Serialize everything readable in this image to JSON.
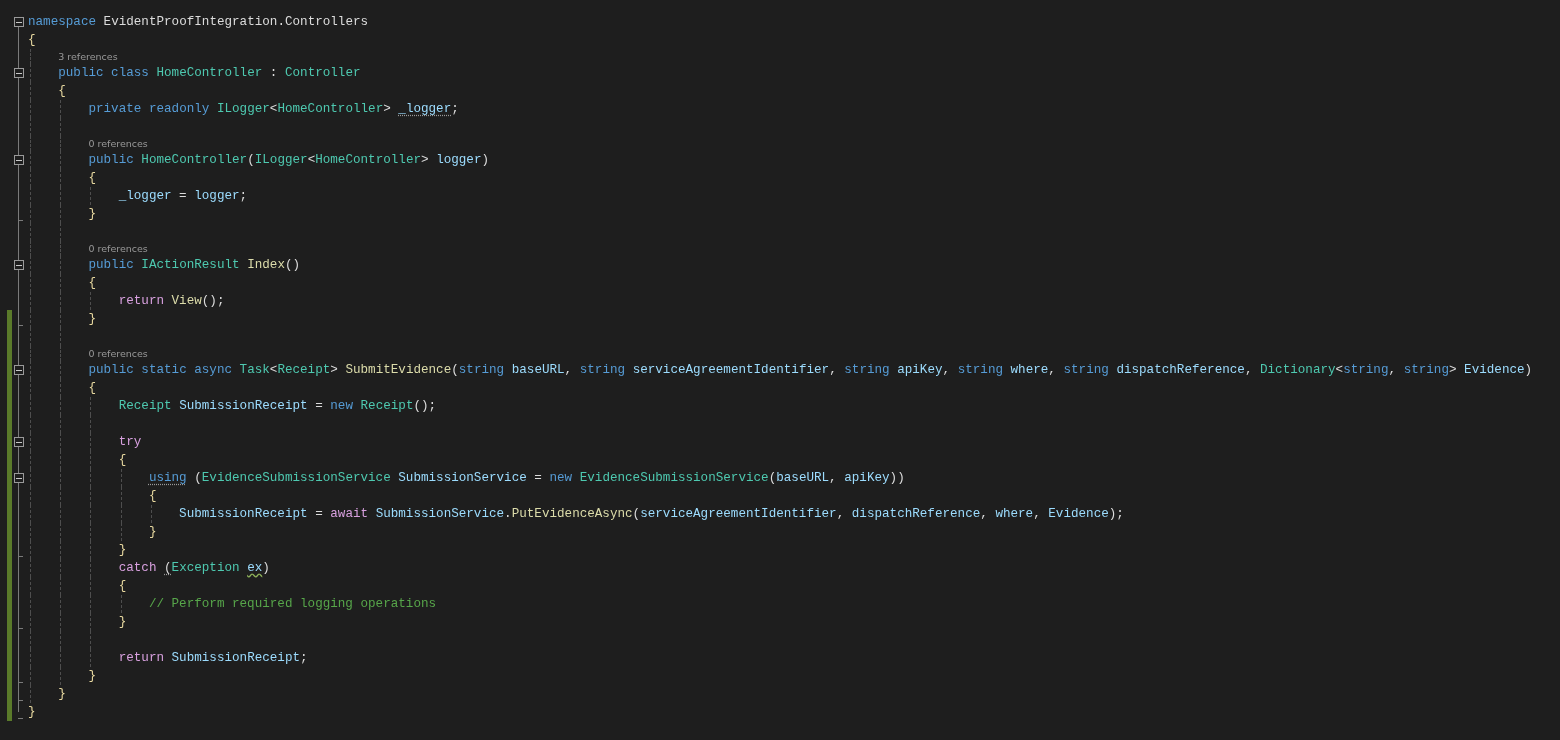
{
  "editor": {
    "lines": [
      {
        "kind": "code",
        "expanded": true,
        "modified": false,
        "tokens": [
          {
            "kind": "keyword",
            "text": "namespace "
          },
          {
            "kind": "plain",
            "text": "EvidentProofIntegration.Controllers"
          }
        ]
      },
      {
        "kind": "code",
        "modified": false,
        "tokens": [
          {
            "kind": "brace",
            "text": "{"
          }
        ],
        "children": [
          {
            "kind": "lens",
            "modified": false,
            "text": "3 references"
          },
          {
            "kind": "code",
            "expanded": true,
            "modified": false,
            "tokens": [
              {
                "kind": "keyword",
                "text": "public class "
              },
              {
                "kind": "type",
                "text": "HomeController"
              },
              {
                "kind": "plain",
                "text": " : "
              },
              {
                "kind": "type",
                "text": "Controller"
              }
            ]
          },
          {
            "kind": "code",
            "modified": false,
            "tokens": [
              {
                "kind": "brace",
                "text": "{"
              }
            ],
            "children": [
              {
                "kind": "code",
                "modified": false,
                "tokens": [
                  {
                    "kind": "keyword",
                    "text": "private readonly "
                  },
                  {
                    "kind": "type",
                    "text": "ILogger"
                  },
                  {
                    "kind": "plain",
                    "text": "<"
                  },
                  {
                    "kind": "type",
                    "text": "HomeController"
                  },
                  {
                    "kind": "plain",
                    "text": "> "
                  },
                  {
                    "kind": "variable",
                    "text": "_logger",
                    "hint": true
                  },
                  {
                    "kind": "plain",
                    "text": ";"
                  }
                ]
              },
              {
                "kind": "blank",
                "modified": false
              },
              {
                "kind": "lens",
                "modified": false,
                "text": "0 references"
              },
              {
                "kind": "code",
                "expanded": true,
                "modified": false,
                "tokens": [
                  {
                    "kind": "keyword",
                    "text": "public "
                  },
                  {
                    "kind": "type",
                    "text": "HomeController"
                  },
                  {
                    "kind": "plain",
                    "text": "("
                  },
                  {
                    "kind": "type",
                    "text": "ILogger"
                  },
                  {
                    "kind": "plain",
                    "text": "<"
                  },
                  {
                    "kind": "type",
                    "text": "HomeController"
                  },
                  {
                    "kind": "plain",
                    "text": "> "
                  },
                  {
                    "kind": "variable",
                    "text": "logger"
                  },
                  {
                    "kind": "plain",
                    "text": ")"
                  }
                ]
              },
              {
                "kind": "code",
                "modified": false,
                "tokens": [
                  {
                    "kind": "brace",
                    "text": "{"
                  }
                ],
                "children": [
                  {
                    "kind": "code",
                    "modified": false,
                    "tokens": [
                      {
                        "kind": "variable",
                        "text": "_logger"
                      },
                      {
                        "kind": "plain",
                        "text": " = "
                      },
                      {
                        "kind": "variable",
                        "text": "logger"
                      },
                      {
                        "kind": "plain",
                        "text": ";"
                      }
                    ]
                  }
                ]
              },
              {
                "kind": "code",
                "fold_end": true,
                "modified": false,
                "tokens": [
                  {
                    "kind": "brace",
                    "text": "}"
                  }
                ]
              },
              {
                "kind": "blank",
                "modified": false
              },
              {
                "kind": "lens",
                "modified": false,
                "text": "0 references"
              },
              {
                "kind": "code",
                "expanded": true,
                "modified": false,
                "tokens": [
                  {
                    "kind": "keyword",
                    "text": "public "
                  },
                  {
                    "kind": "type",
                    "text": "IActionResult"
                  },
                  {
                    "kind": "method",
                    "text": " Index"
                  },
                  {
                    "kind": "plain",
                    "text": "()"
                  }
                ]
              },
              {
                "kind": "code",
                "modified": false,
                "tokens": [
                  {
                    "kind": "brace",
                    "text": "{"
                  }
                ],
                "children": [
                  {
                    "kind": "code",
                    "modified": false,
                    "tokens": [
                      {
                        "kind": "control",
                        "text": "return "
                      },
                      {
                        "kind": "method",
                        "text": "View"
                      },
                      {
                        "kind": "plain",
                        "text": "();"
                      }
                    ]
                  }
                ]
              },
              {
                "kind": "code",
                "fold_end": true,
                "modified": true,
                "tokens": [
                  {
                    "kind": "brace",
                    "text": "}"
                  }
                ]
              },
              {
                "kind": "blank",
                "modified": true
              },
              {
                "kind": "lens",
                "modified": true,
                "text": "0 references"
              },
              {
                "kind": "code",
                "expanded": true,
                "modified": true,
                "tokens": [
                  {
                    "kind": "keyword",
                    "text": "public static async "
                  },
                  {
                    "kind": "type",
                    "text": "Task"
                  },
                  {
                    "kind": "plain",
                    "text": "<"
                  },
                  {
                    "kind": "type",
                    "text": "Receipt"
                  },
                  {
                    "kind": "plain",
                    "text": "> "
                  },
                  {
                    "kind": "method",
                    "text": "SubmitEvidence"
                  },
                  {
                    "kind": "plain",
                    "text": "("
                  },
                  {
                    "kind": "keyword",
                    "text": "string "
                  },
                  {
                    "kind": "variable",
                    "text": "baseURL"
                  },
                  {
                    "kind": "plain",
                    "text": ", "
                  },
                  {
                    "kind": "keyword",
                    "text": "string "
                  },
                  {
                    "kind": "variable",
                    "text": "serviceAgreementIdentifier"
                  },
                  {
                    "kind": "plain",
                    "text": ", "
                  },
                  {
                    "kind": "keyword",
                    "text": "string "
                  },
                  {
                    "kind": "variable",
                    "text": "apiKey"
                  },
                  {
                    "kind": "plain",
                    "text": ", "
                  },
                  {
                    "kind": "keyword",
                    "text": "string "
                  },
                  {
                    "kind": "variable",
                    "text": "where"
                  },
                  {
                    "kind": "plain",
                    "text": ", "
                  },
                  {
                    "kind": "keyword",
                    "text": "string "
                  },
                  {
                    "kind": "variable",
                    "text": "dispatchReference"
                  },
                  {
                    "kind": "plain",
                    "text": ", "
                  },
                  {
                    "kind": "type",
                    "text": "Dictionary"
                  },
                  {
                    "kind": "plain",
                    "text": "<"
                  },
                  {
                    "kind": "keyword",
                    "text": "string"
                  },
                  {
                    "kind": "plain",
                    "text": ", "
                  },
                  {
                    "kind": "keyword",
                    "text": "string"
                  },
                  {
                    "kind": "plain",
                    "text": "> "
                  },
                  {
                    "kind": "variable",
                    "text": "Evidence"
                  },
                  {
                    "kind": "plain",
                    "text": ")"
                  }
                ]
              },
              {
                "kind": "code",
                "modified": true,
                "tokens": [
                  {
                    "kind": "brace",
                    "text": "{"
                  }
                ],
                "children": [
                  {
                    "kind": "code",
                    "modified": true,
                    "tokens": [
                      {
                        "kind": "type",
                        "text": "Receipt "
                      },
                      {
                        "kind": "variable",
                        "text": "SubmissionReceipt"
                      },
                      {
                        "kind": "plain",
                        "text": " = "
                      },
                      {
                        "kind": "keyword",
                        "text": "new "
                      },
                      {
                        "kind": "type",
                        "text": "Receipt"
                      },
                      {
                        "kind": "plain",
                        "text": "();"
                      }
                    ]
                  },
                  {
                    "kind": "blank",
                    "modified": true
                  },
                  {
                    "kind": "code",
                    "expanded": true,
                    "modified": true,
                    "tokens": [
                      {
                        "kind": "control",
                        "text": "try"
                      }
                    ]
                  },
                  {
                    "kind": "code",
                    "modified": true,
                    "tokens": [
                      {
                        "kind": "brace",
                        "text": "{"
                      }
                    ],
                    "children": [
                      {
                        "kind": "code",
                        "expanded": true,
                        "modified": true,
                        "tokens": [
                          {
                            "kind": "keyword",
                            "text": "using",
                            "hint": true
                          },
                          {
                            "kind": "plain",
                            "text": " ("
                          },
                          {
                            "kind": "type",
                            "text": "EvidenceSubmissionService "
                          },
                          {
                            "kind": "variable",
                            "text": "SubmissionService"
                          },
                          {
                            "kind": "plain",
                            "text": " = "
                          },
                          {
                            "kind": "keyword",
                            "text": "new "
                          },
                          {
                            "kind": "type",
                            "text": "EvidenceSubmissionService"
                          },
                          {
                            "kind": "plain",
                            "text": "("
                          },
                          {
                            "kind": "variable",
                            "text": "baseURL"
                          },
                          {
                            "kind": "plain",
                            "text": ", "
                          },
                          {
                            "kind": "variable",
                            "text": "apiKey"
                          },
                          {
                            "kind": "plain",
                            "text": "))"
                          }
                        ]
                      },
                      {
                        "kind": "code",
                        "modified": true,
                        "tokens": [
                          {
                            "kind": "brace",
                            "text": "{"
                          }
                        ],
                        "children": [
                          {
                            "kind": "code",
                            "modified": true,
                            "tokens": [
                              {
                                "kind": "variable",
                                "text": "SubmissionReceipt"
                              },
                              {
                                "kind": "plain",
                                "text": " = "
                              },
                              {
                                "kind": "control",
                                "text": "await "
                              },
                              {
                                "kind": "variable",
                                "text": "SubmissionService"
                              },
                              {
                                "kind": "plain",
                                "text": "."
                              },
                              {
                                "kind": "method",
                                "text": "PutEvidenceAsync"
                              },
                              {
                                "kind": "plain",
                                "text": "("
                              },
                              {
                                "kind": "variable",
                                "text": "serviceAgreementIdentifier"
                              },
                              {
                                "kind": "plain",
                                "text": ", "
                              },
                              {
                                "kind": "variable",
                                "text": "dispatchReference"
                              },
                              {
                                "kind": "plain",
                                "text": ", "
                              },
                              {
                                "kind": "variable",
                                "text": "where"
                              },
                              {
                                "kind": "plain",
                                "text": ", "
                              },
                              {
                                "kind": "variable",
                                "text": "Evidence"
                              },
                              {
                                "kind": "plain",
                                "text": ");"
                              }
                            ]
                          }
                        ]
                      },
                      {
                        "kind": "code",
                        "modified": true,
                        "tokens": [
                          {
                            "kind": "brace",
                            "text": "}"
                          }
                        ]
                      }
                    ]
                  },
                  {
                    "kind": "code",
                    "fold_end": true,
                    "modified": true,
                    "tokens": [
                      {
                        "kind": "brace",
                        "text": "}"
                      }
                    ]
                  },
                  {
                    "kind": "code",
                    "modified": true,
                    "tokens": [
                      {
                        "kind": "control",
                        "text": "catch "
                      },
                      {
                        "kind": "plain",
                        "text": "(",
                        "hint": true
                      },
                      {
                        "kind": "type",
                        "text": "Exception "
                      },
                      {
                        "kind": "variable",
                        "text": "ex",
                        "warning": true
                      },
                      {
                        "kind": "plain",
                        "text": ")"
                      }
                    ]
                  },
                  {
                    "kind": "code",
                    "modified": true,
                    "tokens": [
                      {
                        "kind": "brace",
                        "text": "{"
                      }
                    ],
                    "children": [
                      {
                        "kind": "code",
                        "modified": true,
                        "tokens": [
                          {
                            "kind": "comment",
                            "text": "// Perform required logging operations"
                          }
                        ]
                      }
                    ]
                  },
                  {
                    "kind": "code",
                    "fold_end": true,
                    "modified": true,
                    "tokens": [
                      {
                        "kind": "brace",
                        "text": "}"
                      }
                    ]
                  },
                  {
                    "kind": "blank",
                    "modified": true
                  },
                  {
                    "kind": "code",
                    "modified": true,
                    "tokens": [
                      {
                        "kind": "control",
                        "text": "return "
                      },
                      {
                        "kind": "variable",
                        "text": "SubmissionReceipt"
                      },
                      {
                        "kind": "plain",
                        "text": ";"
                      }
                    ]
                  }
                ]
              },
              {
                "kind": "code",
                "fold_end": true,
                "modified": true,
                "tokens": [
                  {
                    "kind": "brace",
                    "text": "}"
                  }
                ]
              }
            ]
          },
          {
            "kind": "code",
            "fold_end": true,
            "modified": true,
            "tokens": [
              {
                "kind": "brace",
                "text": "}"
              }
            ]
          }
        ]
      },
      {
        "kind": "code",
        "fold_end": true,
        "modified": true,
        "tokens": [
          {
            "kind": "brace",
            "text": "}"
          }
        ]
      }
    ]
  }
}
